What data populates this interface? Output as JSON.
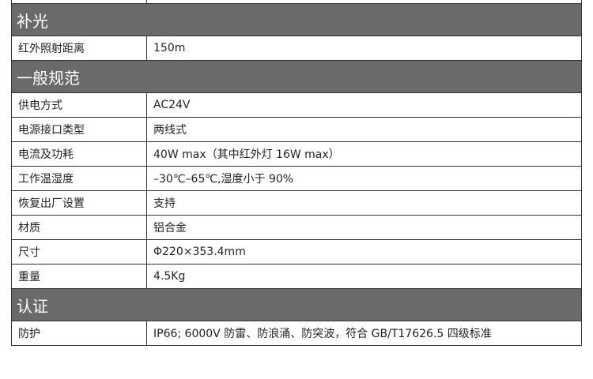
{
  "sections": [
    {
      "title": "补光",
      "rows": [
        {
          "label": "红外照射距离",
          "value": "150m"
        }
      ]
    },
    {
      "title": "一般规范",
      "rows": [
        {
          "label": "供电方式",
          "value": "AC24V"
        },
        {
          "label": "电源接口类型",
          "value": "两线式"
        },
        {
          "label": "电流及功耗",
          "value": "40W max（其中红外灯 16W max）"
        },
        {
          "label": "工作温湿度",
          "value": "–30℃–65℃,湿度小于 90%"
        },
        {
          "label": "恢复出厂设置",
          "value": "支持"
        },
        {
          "label": "材质",
          "value": "铝合金"
        },
        {
          "label": "尺寸",
          "value": "Φ220×353.4mm"
        },
        {
          "label": "重量",
          "value": "4.5Kg"
        }
      ]
    },
    {
      "title": "认证",
      "rows": [
        {
          "label": "防护",
          "value": "IP66; 6000V 防雷、防浪涌、防突波，符合 GB/T17626.5 四级标准"
        }
      ]
    }
  ]
}
